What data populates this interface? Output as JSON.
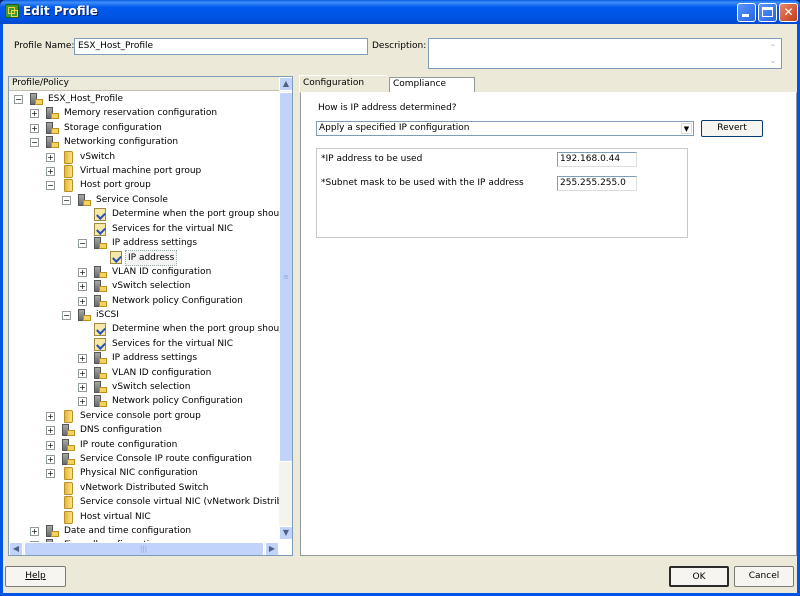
{
  "window": {
    "title": "Edit Profile",
    "icons": {
      "app": "vsphere-profile-icon",
      "minimize": "minimize-icon",
      "maximize": "maximize-icon",
      "close": "close-icon"
    }
  },
  "header": {
    "profile_name_label": "Profile Name:",
    "profile_name_value": "ESX_Host_Profile",
    "description_label": "Description:",
    "description_value": ""
  },
  "tree": {
    "header": "Profile/Policy",
    "items": [
      {
        "label": "ESX_Host_Profile",
        "level": 0,
        "expander": "minus",
        "icon": "profile"
      },
      {
        "label": "Memory reservation configuration",
        "level": 1,
        "expander": "plus",
        "icon": "profile"
      },
      {
        "label": "Storage configuration",
        "level": 1,
        "expander": "plus",
        "icon": "profile"
      },
      {
        "label": "Networking configuration",
        "level": 1,
        "expander": "minus",
        "icon": "profile"
      },
      {
        "label": "vSwitch",
        "level": 2,
        "expander": "plus",
        "icon": "folder"
      },
      {
        "label": "Virtual machine port group",
        "level": 2,
        "expander": "plus",
        "icon": "folder"
      },
      {
        "label": "Host port group",
        "level": 2,
        "expander": "minus",
        "icon": "folder"
      },
      {
        "label": "Service Console",
        "level": 3,
        "expander": "minus",
        "icon": "profile"
      },
      {
        "label": "Determine when the port group should ...",
        "level": 4,
        "expander": "none",
        "icon": "policy"
      },
      {
        "label": "Services for the virtual NIC",
        "level": 4,
        "expander": "none",
        "icon": "policy"
      },
      {
        "label": "IP address settings",
        "level": 4,
        "expander": "minus",
        "icon": "profile"
      },
      {
        "label": "IP address",
        "level": 5,
        "expander": "none",
        "icon": "policy",
        "selected": true
      },
      {
        "label": "VLAN ID configuration",
        "level": 4,
        "expander": "plus",
        "icon": "profile"
      },
      {
        "label": "vSwitch selection",
        "level": 4,
        "expander": "plus",
        "icon": "profile"
      },
      {
        "label": "Network policy Configuration",
        "level": 4,
        "expander": "plus",
        "icon": "profile"
      },
      {
        "label": "iSCSI",
        "level": 3,
        "expander": "minus",
        "icon": "profile"
      },
      {
        "label": "Determine when the port group should ...",
        "level": 4,
        "expander": "none",
        "icon": "policy"
      },
      {
        "label": "Services for the virtual NIC",
        "level": 4,
        "expander": "none",
        "icon": "policy"
      },
      {
        "label": "IP address settings",
        "level": 4,
        "expander": "plus",
        "icon": "profile"
      },
      {
        "label": "VLAN ID configuration",
        "level": 4,
        "expander": "plus",
        "icon": "profile"
      },
      {
        "label": "vSwitch selection",
        "level": 4,
        "expander": "plus",
        "icon": "profile"
      },
      {
        "label": "Network policy Configuration",
        "level": 4,
        "expander": "plus",
        "icon": "profile"
      },
      {
        "label": "Service console port group",
        "level": 2,
        "expander": "plus",
        "icon": "folder"
      },
      {
        "label": "DNS configuration",
        "level": 2,
        "expander": "plus",
        "icon": "profile"
      },
      {
        "label": "IP route configuration",
        "level": 2,
        "expander": "plus",
        "icon": "profile"
      },
      {
        "label": "Service Console IP route configuration",
        "level": 2,
        "expander": "plus",
        "icon": "profile"
      },
      {
        "label": "Physical NIC configuration",
        "level": 2,
        "expander": "plus",
        "icon": "folder"
      },
      {
        "label": "vNetwork Distributed Switch",
        "level": 2,
        "expander": "none",
        "icon": "folder"
      },
      {
        "label": "Service console virtual NIC (vNetwork Distributed...",
        "level": 2,
        "expander": "none",
        "icon": "folder"
      },
      {
        "label": "Host virtual NIC",
        "level": 2,
        "expander": "none",
        "icon": "folder"
      },
      {
        "label": "Date and time configuration",
        "level": 1,
        "expander": "plus",
        "icon": "profile"
      },
      {
        "label": "Firewall configuration",
        "level": 1,
        "expander": "minus",
        "icon": "profile"
      }
    ]
  },
  "tabs": [
    {
      "label": "Configuration Details",
      "active": true
    },
    {
      "label": "Compliance Details",
      "active": false
    }
  ],
  "config": {
    "question": "How is IP address determined?",
    "dropdown_value": "Apply a specified IP configuration",
    "revert_label": "Revert",
    "fields": [
      {
        "label": "*IP address to be used",
        "value": "192.168.0.44"
      },
      {
        "label": "*Subnet mask to be used with the IP address",
        "value": "255.255.255.0"
      }
    ]
  },
  "footer": {
    "help_label": "Help",
    "ok_label": "OK",
    "cancel_label": "Cancel"
  }
}
